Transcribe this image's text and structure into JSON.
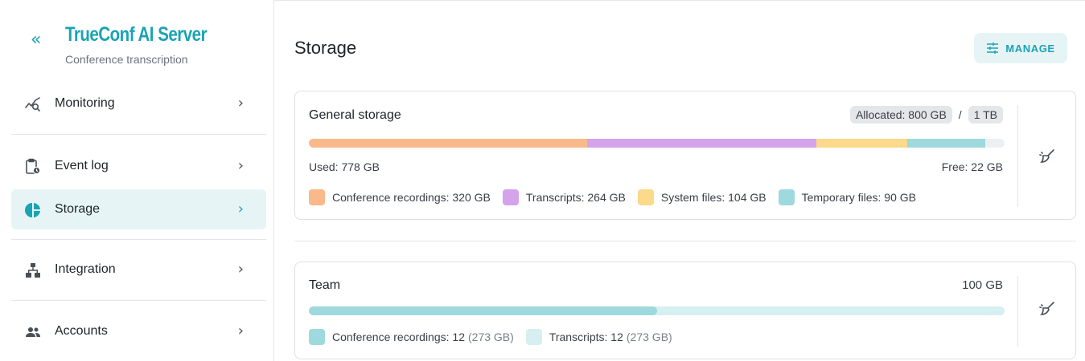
{
  "sidebar": {
    "brand_title": "TrueConf AI Server",
    "brand_subtitle": "Conference transcription",
    "collapse_icon": "«",
    "items": [
      {
        "label": "Monitoring",
        "icon": "monitoring-icon"
      },
      {
        "label": "Event log",
        "icon": "event-log-icon"
      },
      {
        "label": "Storage",
        "icon": "storage-pie-icon",
        "active": true
      },
      {
        "label": "Integration",
        "icon": "integration-icon"
      },
      {
        "label": "Accounts",
        "icon": "accounts-icon"
      }
    ]
  },
  "main": {
    "title": "Storage",
    "manage_label": "MANAGE",
    "general": {
      "title": "General storage",
      "allocated": "Allocated: 800 GB",
      "slash": "/",
      "total": "1 TB",
      "used": "Used: 778 GB",
      "free": "Free: 22 GB",
      "segments": [
        {
          "label": "Conference recordings: 320 GB",
          "value_gb": 320,
          "color": "#f9b98a"
        },
        {
          "label": "Transcripts: 264 GB",
          "value_gb": 264,
          "color": "#d4a3ec"
        },
        {
          "label": "System files: 104 GB",
          "value_gb": 104,
          "color": "#fcd98b"
        },
        {
          "label": "Temporary files: 90 GB",
          "value_gb": 90,
          "color": "#9ed9dd"
        }
      ],
      "capacity_gb": 800
    },
    "team": {
      "title": "Team",
      "size": "100 GB",
      "fill_fraction": 0.5,
      "fill_color": "#9ed9dd",
      "legend": [
        {
          "label": "Conference recordings: 12",
          "extra": "(273 GB)",
          "color": "#9ed9dd"
        },
        {
          "label": "Transcripts: 12",
          "extra": "(273 GB)",
          "color": "#d6eff1"
        }
      ]
    }
  },
  "colors": {
    "accent": "#1aa3b4",
    "active_bg": "#e6f4f6"
  }
}
